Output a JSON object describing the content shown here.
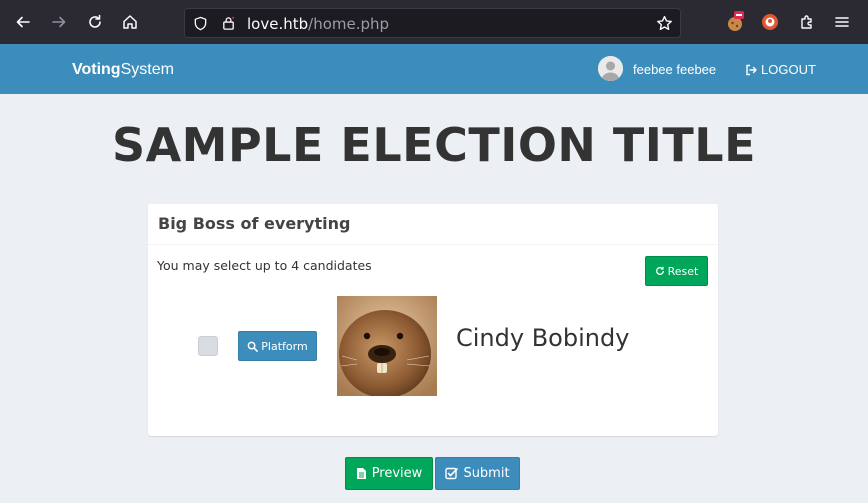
{
  "browser": {
    "url_host": "love.htb",
    "url_path": "/home.php"
  },
  "navbar": {
    "brand_bold": "Voting",
    "brand_rest": "System",
    "username": "feebee feebee",
    "logout_label": "LOGOUT"
  },
  "election": {
    "title": "SAMPLE ELECTION TITLE"
  },
  "position": {
    "title": "Big Boss of everyting",
    "instructions": "You may select up to 4 candidates",
    "reset_label": "Reset",
    "candidates": [
      {
        "name": "Cindy Bobindy",
        "platform_label": "Platform",
        "selected": false
      }
    ]
  },
  "actions": {
    "preview_label": "Preview",
    "submit_label": "Submit"
  },
  "colors": {
    "primary": "#3c8dbc",
    "success": "#00a65a",
    "page_bg": "#ecf0f5",
    "browser_bg": "#2b2a33"
  }
}
